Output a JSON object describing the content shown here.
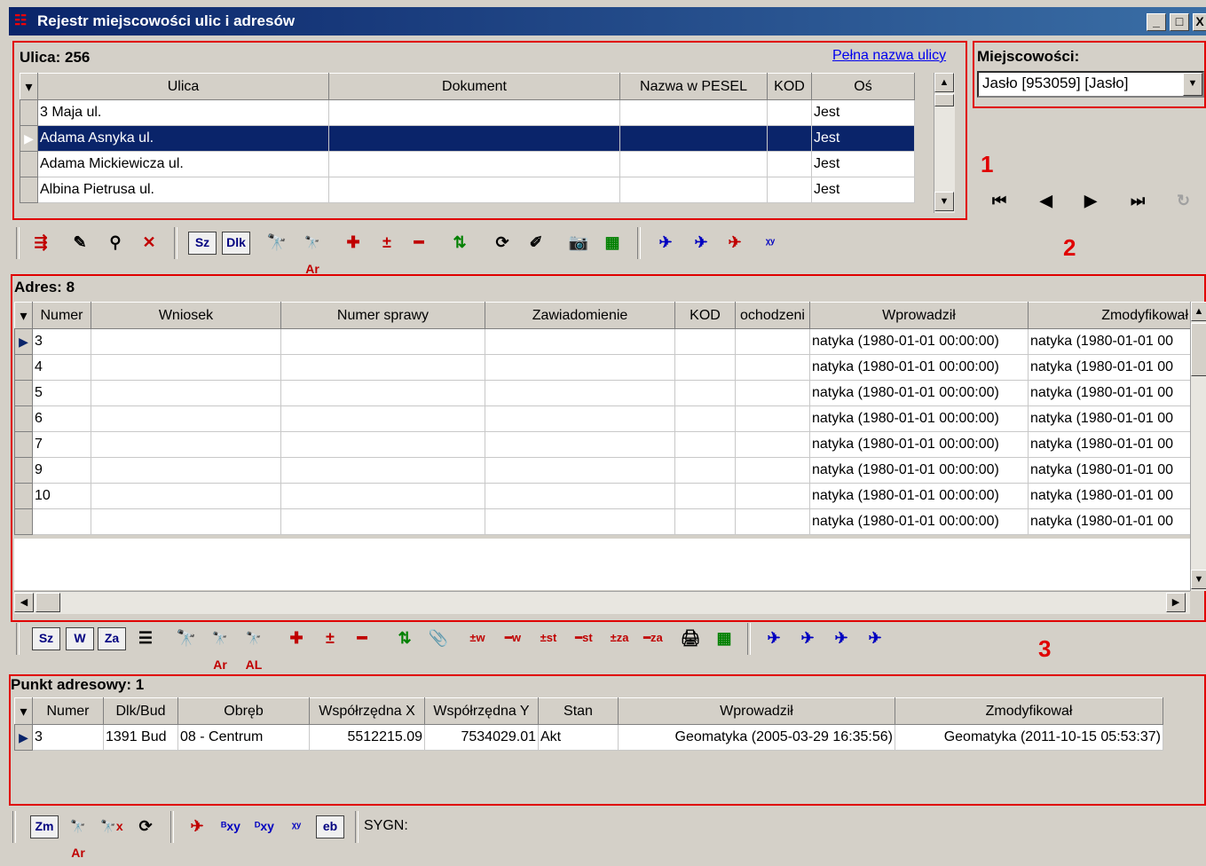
{
  "window": {
    "title": "Rejestr miejscowości ulic i adresów",
    "min": "_",
    "max": "□",
    "close": "X"
  },
  "street": {
    "header": "Ulica: 256",
    "full_name_link": "Pełna nazwa ulicy",
    "columns": [
      "Ulica",
      "Dokument",
      "Nazwa w PESEL",
      "KOD",
      "Oś"
    ],
    "rows": [
      [
        "3 Maja ul.",
        "",
        "",
        "",
        "Jest"
      ],
      [
        "Adama Asnyka ul.",
        "",
        "",
        "",
        "Jest"
      ],
      [
        "Adama Mickiewicza ul.",
        "",
        "",
        "",
        "Jest"
      ],
      [
        "Albina Pietrusa ul.",
        "",
        "",
        "",
        "Jest"
      ]
    ],
    "selected_row": 1
  },
  "locality": {
    "label": "Miejscowości:",
    "value": "Jasło [953059] [Jasło]"
  },
  "navigator": {
    "first": "⏮",
    "prev": "◀",
    "next": "▶",
    "last": "⏭",
    "refresh": "↻"
  },
  "labels": {
    "one": "1",
    "two": "2",
    "three": "3"
  },
  "toolbar1": [
    "⇶",
    "✎",
    "⚲",
    "✕",
    "Sz",
    "Dlk",
    "🔭",
    "🔭Ar",
    "✚",
    "±",
    "━",
    "⇅",
    "⟳",
    "✐",
    "📷",
    "▦",
    "✈",
    "✈",
    "✈",
    "ᵡʸ"
  ],
  "address": {
    "header": "Adres: 8",
    "columns": [
      "Numer",
      "Wniosek",
      "Numer sprawy",
      "Zawiadomienie",
      "KOD",
      "ochodzeni",
      "Wprowadził",
      "Zmodyfikował"
    ],
    "rows": [
      [
        "3",
        "",
        "",
        "",
        "",
        "",
        "natyka (1980-01-01 00:00:00)",
        "natyka (1980-01-01 00"
      ],
      [
        "4",
        "",
        "",
        "",
        "",
        "",
        "natyka (1980-01-01 00:00:00)",
        "natyka (1980-01-01 00"
      ],
      [
        "5",
        "",
        "",
        "",
        "",
        "",
        "natyka (1980-01-01 00:00:00)",
        "natyka (1980-01-01 00"
      ],
      [
        "6",
        "",
        "",
        "",
        "",
        "",
        "natyka (1980-01-01 00:00:00)",
        "natyka (1980-01-01 00"
      ],
      [
        "7",
        "",
        "",
        "",
        "",
        "",
        "natyka (1980-01-01 00:00:00)",
        "natyka (1980-01-01 00"
      ],
      [
        "9",
        "",
        "",
        "",
        "",
        "",
        "natyka (1980-01-01 00:00:00)",
        "natyka (1980-01-01 00"
      ],
      [
        "10",
        "",
        "",
        "",
        "",
        "",
        "natyka (1980-01-01 00:00:00)",
        "natyka (1980-01-01 00"
      ],
      [
        "",
        "",
        "",
        "",
        "",
        "",
        "natyka (1980-01-01 00:00:00)",
        "natyka (1980-01-01 00"
      ]
    ]
  },
  "toolbar2": [
    "Sz",
    "W",
    "Za",
    "☰",
    "🔭",
    "🔭Ar",
    "🔭AL",
    "✚",
    "±",
    "━",
    "⇅",
    "📎",
    "±w",
    "━w",
    "±st",
    "━st",
    "±za",
    "━za",
    "🖨",
    "▦",
    "✈",
    "✈",
    "✈",
    "✈"
  ],
  "point": {
    "header": "Punkt adresowy: 1",
    "columns": [
      "Numer",
      "Dlk/Bud",
      "Obręb",
      "Współrzędna X",
      "Współrzędna Y",
      "Stan",
      "Wprowadził",
      "Zmodyfikował"
    ],
    "rows": [
      [
        "3",
        "1391 Bud",
        "08 - Centrum",
        "5512215.09",
        "7534029.01",
        "Akt",
        "Geomatyka (2005-03-29 16:35:56)",
        "Geomatyka (2011-10-15 05:53:37)"
      ]
    ]
  },
  "toolbar3": [
    "Zm",
    "🔭Ar",
    "🔭x",
    "⟳",
    "✈",
    "ᴮxy",
    "ᴰxy",
    "ᵡʸ",
    "eb"
  ],
  "sygn": "SYGN:"
}
